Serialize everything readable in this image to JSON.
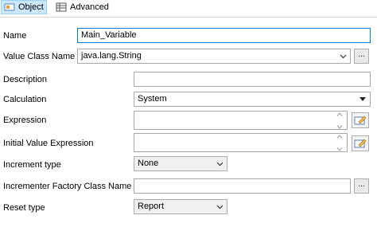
{
  "tabs": [
    {
      "label": "Object",
      "icon": "object-tab-icon",
      "active": true
    },
    {
      "label": "Advanced",
      "icon": "table-icon",
      "active": false
    }
  ],
  "form": {
    "name": {
      "label": "Name",
      "value": "Main_Variable"
    },
    "value_class_name": {
      "label": "Value Class Name",
      "value": "java.lang.String",
      "browse": "..."
    },
    "description": {
      "label": "Description",
      "value": ""
    },
    "calculation": {
      "label": "Calculation",
      "value": "System"
    },
    "expression": {
      "label": "Expression",
      "value": ""
    },
    "initial_value_expression": {
      "label": "Initial Value Expression",
      "value": ""
    },
    "increment_type": {
      "label": "Increment type",
      "value": "None"
    },
    "incrementer_factory": {
      "label": "Incrementer Factory Class Name",
      "value": "",
      "browse": "..."
    },
    "reset_type": {
      "label": "Reset type",
      "value": "Report"
    }
  },
  "colors": {
    "accent": "#0078d7",
    "tab_active_bg": "#cce8ff"
  }
}
